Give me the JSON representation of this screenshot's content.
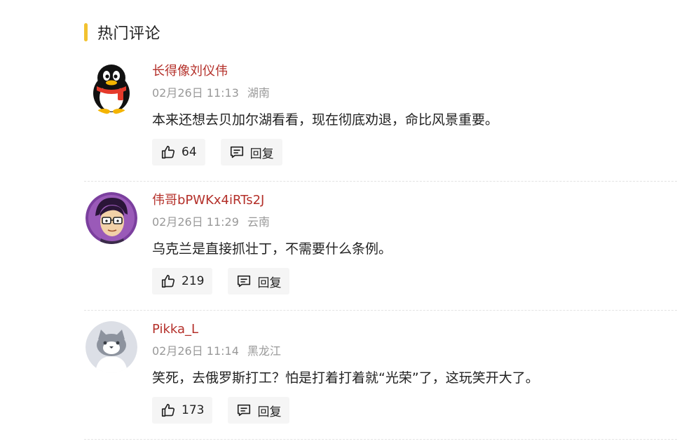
{
  "section": {
    "title": "热门评论"
  },
  "comments": [
    {
      "username": "长得像刘仪伟",
      "time": "02月26日 11:13",
      "location": "湖南",
      "text": "本来还想去贝加尔湖看看，现在彻底劝退，命比风景重要。",
      "likes": "64",
      "reply_label": "回复",
      "avatar_icon": "qq-penguin-avatar"
    },
    {
      "username": "伟哥bPWKx4iRTs2J",
      "time": "02月26日 11:29",
      "location": "云南",
      "text": "乌克兰是直接抓壮丁，不需要什么条例。",
      "likes": "219",
      "reply_label": "回复",
      "avatar_icon": "cartoon-man-glasses-avatar"
    },
    {
      "username": "Pikka_L",
      "time": "02月26日 11:14",
      "location": "黑龙江",
      "text": "笑死，去俄罗斯打工？怕是打着打着就“光荣”了，这玩笑开大了。",
      "likes": "173",
      "reply_label": "回复",
      "avatar_icon": "default-cat-avatar"
    }
  ],
  "colors": {
    "accent_bar": "#f2c230",
    "username": "#b4302a",
    "meta": "#999999",
    "button_bg": "#f5f5f5"
  }
}
